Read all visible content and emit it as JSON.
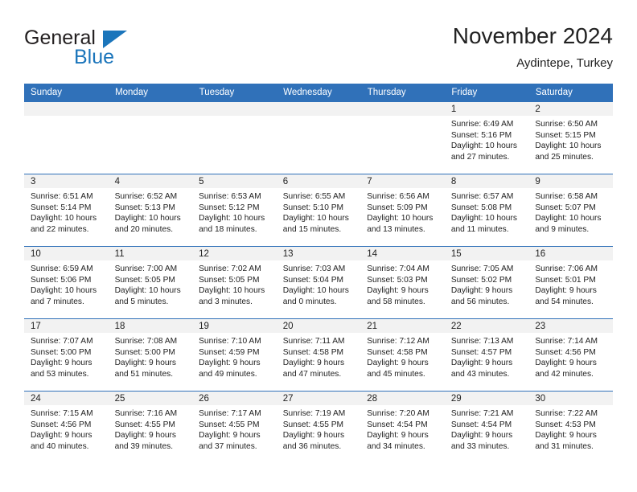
{
  "brand": {
    "name_primary": "General",
    "name_secondary": "Blue",
    "triangle_icon": "triangle-icon",
    "accent_color": "#1b75bb"
  },
  "header": {
    "title": "November 2024",
    "subtitle": "Aydintepe, Turkey"
  },
  "colors": {
    "header_blue": "#3071b9",
    "daystrip_gray": "#f2f2f2",
    "text": "#222222"
  },
  "weekdays": [
    "Sunday",
    "Monday",
    "Tuesday",
    "Wednesday",
    "Thursday",
    "Friday",
    "Saturday"
  ],
  "weeks": [
    [
      {
        "day": "",
        "empty": true
      },
      {
        "day": "",
        "empty": true
      },
      {
        "day": "",
        "empty": true
      },
      {
        "day": "",
        "empty": true
      },
      {
        "day": "",
        "empty": true
      },
      {
        "day": "1",
        "sunrise": "Sunrise: 6:49 AM",
        "sunset": "Sunset: 5:16 PM",
        "daylight_1": "Daylight: 10 hours",
        "daylight_2": "and 27 minutes."
      },
      {
        "day": "2",
        "sunrise": "Sunrise: 6:50 AM",
        "sunset": "Sunset: 5:15 PM",
        "daylight_1": "Daylight: 10 hours",
        "daylight_2": "and 25 minutes."
      }
    ],
    [
      {
        "day": "3",
        "sunrise": "Sunrise: 6:51 AM",
        "sunset": "Sunset: 5:14 PM",
        "daylight_1": "Daylight: 10 hours",
        "daylight_2": "and 22 minutes."
      },
      {
        "day": "4",
        "sunrise": "Sunrise: 6:52 AM",
        "sunset": "Sunset: 5:13 PM",
        "daylight_1": "Daylight: 10 hours",
        "daylight_2": "and 20 minutes."
      },
      {
        "day": "5",
        "sunrise": "Sunrise: 6:53 AM",
        "sunset": "Sunset: 5:12 PM",
        "daylight_1": "Daylight: 10 hours",
        "daylight_2": "and 18 minutes."
      },
      {
        "day": "6",
        "sunrise": "Sunrise: 6:55 AM",
        "sunset": "Sunset: 5:10 PM",
        "daylight_1": "Daylight: 10 hours",
        "daylight_2": "and 15 minutes."
      },
      {
        "day": "7",
        "sunrise": "Sunrise: 6:56 AM",
        "sunset": "Sunset: 5:09 PM",
        "daylight_1": "Daylight: 10 hours",
        "daylight_2": "and 13 minutes."
      },
      {
        "day": "8",
        "sunrise": "Sunrise: 6:57 AM",
        "sunset": "Sunset: 5:08 PM",
        "daylight_1": "Daylight: 10 hours",
        "daylight_2": "and 11 minutes."
      },
      {
        "day": "9",
        "sunrise": "Sunrise: 6:58 AM",
        "sunset": "Sunset: 5:07 PM",
        "daylight_1": "Daylight: 10 hours",
        "daylight_2": "and 9 minutes."
      }
    ],
    [
      {
        "day": "10",
        "sunrise": "Sunrise: 6:59 AM",
        "sunset": "Sunset: 5:06 PM",
        "daylight_1": "Daylight: 10 hours",
        "daylight_2": "and 7 minutes."
      },
      {
        "day": "11",
        "sunrise": "Sunrise: 7:00 AM",
        "sunset": "Sunset: 5:05 PM",
        "daylight_1": "Daylight: 10 hours",
        "daylight_2": "and 5 minutes."
      },
      {
        "day": "12",
        "sunrise": "Sunrise: 7:02 AM",
        "sunset": "Sunset: 5:05 PM",
        "daylight_1": "Daylight: 10 hours",
        "daylight_2": "and 3 minutes."
      },
      {
        "day": "13",
        "sunrise": "Sunrise: 7:03 AM",
        "sunset": "Sunset: 5:04 PM",
        "daylight_1": "Daylight: 10 hours",
        "daylight_2": "and 0 minutes."
      },
      {
        "day": "14",
        "sunrise": "Sunrise: 7:04 AM",
        "sunset": "Sunset: 5:03 PM",
        "daylight_1": "Daylight: 9 hours",
        "daylight_2": "and 58 minutes."
      },
      {
        "day": "15",
        "sunrise": "Sunrise: 7:05 AM",
        "sunset": "Sunset: 5:02 PM",
        "daylight_1": "Daylight: 9 hours",
        "daylight_2": "and 56 minutes."
      },
      {
        "day": "16",
        "sunrise": "Sunrise: 7:06 AM",
        "sunset": "Sunset: 5:01 PM",
        "daylight_1": "Daylight: 9 hours",
        "daylight_2": "and 54 minutes."
      }
    ],
    [
      {
        "day": "17",
        "sunrise": "Sunrise: 7:07 AM",
        "sunset": "Sunset: 5:00 PM",
        "daylight_1": "Daylight: 9 hours",
        "daylight_2": "and 53 minutes."
      },
      {
        "day": "18",
        "sunrise": "Sunrise: 7:08 AM",
        "sunset": "Sunset: 5:00 PM",
        "daylight_1": "Daylight: 9 hours",
        "daylight_2": "and 51 minutes."
      },
      {
        "day": "19",
        "sunrise": "Sunrise: 7:10 AM",
        "sunset": "Sunset: 4:59 PM",
        "daylight_1": "Daylight: 9 hours",
        "daylight_2": "and 49 minutes."
      },
      {
        "day": "20",
        "sunrise": "Sunrise: 7:11 AM",
        "sunset": "Sunset: 4:58 PM",
        "daylight_1": "Daylight: 9 hours",
        "daylight_2": "and 47 minutes."
      },
      {
        "day": "21",
        "sunrise": "Sunrise: 7:12 AM",
        "sunset": "Sunset: 4:58 PM",
        "daylight_1": "Daylight: 9 hours",
        "daylight_2": "and 45 minutes."
      },
      {
        "day": "22",
        "sunrise": "Sunrise: 7:13 AM",
        "sunset": "Sunset: 4:57 PM",
        "daylight_1": "Daylight: 9 hours",
        "daylight_2": "and 43 minutes."
      },
      {
        "day": "23",
        "sunrise": "Sunrise: 7:14 AM",
        "sunset": "Sunset: 4:56 PM",
        "daylight_1": "Daylight: 9 hours",
        "daylight_2": "and 42 minutes."
      }
    ],
    [
      {
        "day": "24",
        "sunrise": "Sunrise: 7:15 AM",
        "sunset": "Sunset: 4:56 PM",
        "daylight_1": "Daylight: 9 hours",
        "daylight_2": "and 40 minutes."
      },
      {
        "day": "25",
        "sunrise": "Sunrise: 7:16 AM",
        "sunset": "Sunset: 4:55 PM",
        "daylight_1": "Daylight: 9 hours",
        "daylight_2": "and 39 minutes."
      },
      {
        "day": "26",
        "sunrise": "Sunrise: 7:17 AM",
        "sunset": "Sunset: 4:55 PM",
        "daylight_1": "Daylight: 9 hours",
        "daylight_2": "and 37 minutes."
      },
      {
        "day": "27",
        "sunrise": "Sunrise: 7:19 AM",
        "sunset": "Sunset: 4:55 PM",
        "daylight_1": "Daylight: 9 hours",
        "daylight_2": "and 36 minutes."
      },
      {
        "day": "28",
        "sunrise": "Sunrise: 7:20 AM",
        "sunset": "Sunset: 4:54 PM",
        "daylight_1": "Daylight: 9 hours",
        "daylight_2": "and 34 minutes."
      },
      {
        "day": "29",
        "sunrise": "Sunrise: 7:21 AM",
        "sunset": "Sunset: 4:54 PM",
        "daylight_1": "Daylight: 9 hours",
        "daylight_2": "and 33 minutes."
      },
      {
        "day": "30",
        "sunrise": "Sunrise: 7:22 AM",
        "sunset": "Sunset: 4:53 PM",
        "daylight_1": "Daylight: 9 hours",
        "daylight_2": "and 31 minutes."
      }
    ]
  ]
}
